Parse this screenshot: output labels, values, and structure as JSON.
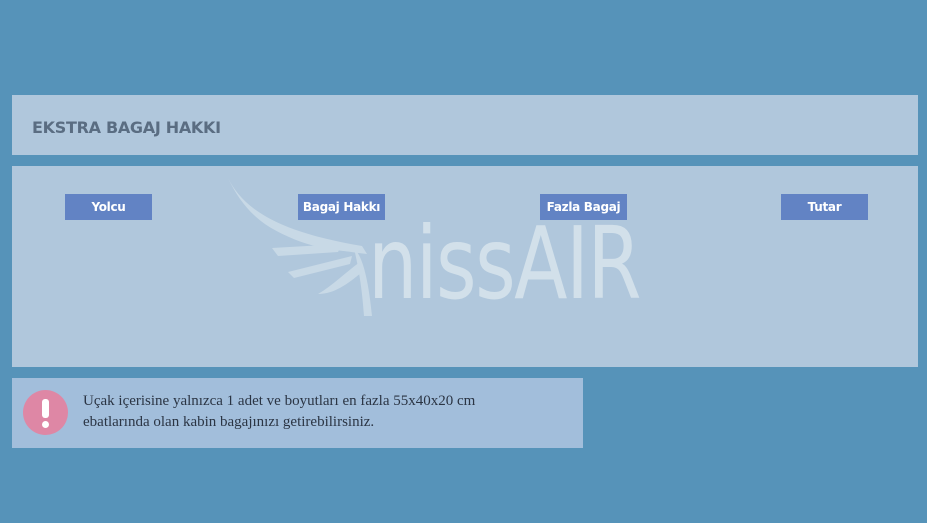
{
  "section": {
    "title": "EKSTRA BAGAJ HAKKI"
  },
  "table": {
    "columns": [
      "Yolcu",
      "Bagaj Hakkı",
      "Fazla Bagaj",
      "Tutar"
    ],
    "rows": []
  },
  "watermark": {
    "brand": "nissAIR",
    "icon": "airplane-wing-logo"
  },
  "notice": {
    "icon": "exclamation-icon",
    "message": "Uçak içerisine yalnızca 1 adet ve boyutları en fazla 55x40x20 cm ebatlarında olan kabin bagajınızı getirebilirsiniz."
  },
  "colors": {
    "background": "#5693b9",
    "panel": "#b0c7dc",
    "header_button": "#6283c4",
    "notice_bg": "#a2bedb",
    "alert": "#de87a5"
  }
}
